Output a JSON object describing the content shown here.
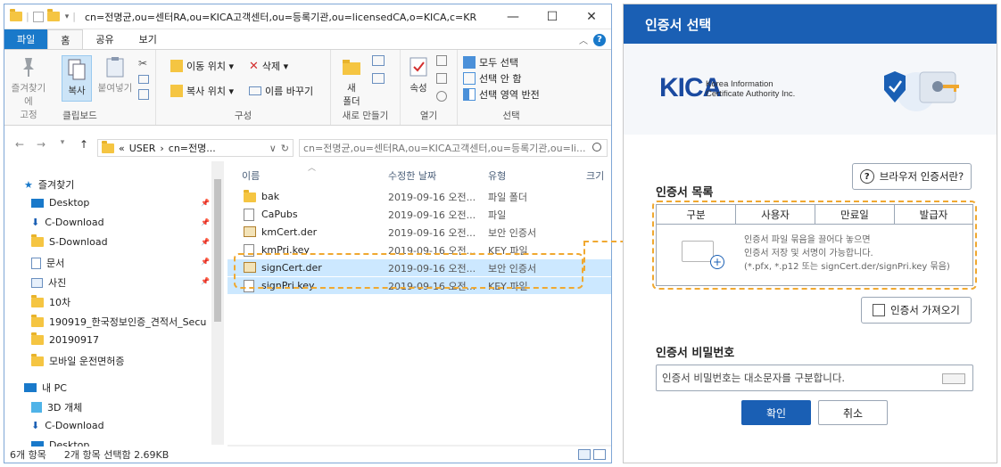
{
  "explorer": {
    "title": "cn=전명균,ou=센터RA,ou=KICA고객센터,ou=등록기관,ou=licensedCA,o=KICA,c=KR",
    "window_buttons": {
      "minimize": "—",
      "maximize": "☐",
      "close": "✕"
    },
    "tabs": [
      {
        "label": "파일"
      },
      {
        "label": "홈"
      },
      {
        "label": "공유"
      },
      {
        "label": "보기"
      }
    ],
    "ribbon": {
      "clipboard": {
        "pin_label": "즐겨찾기에\n고정",
        "copy_label": "복사",
        "paste_label": "붙여넣기",
        "group_label": "클립보드"
      },
      "organize": {
        "move_label": "이동 위치 ▾",
        "copy_to_label": "복사 위치 ▾",
        "delete_label": "삭제 ▾",
        "rename_label": "이름 바꾸기",
        "group_label": "구성"
      },
      "new": {
        "new_folder_label": "새\n폴더",
        "group_label": "새로 만들기"
      },
      "open": {
        "properties_label": "속성",
        "group_label": "열기"
      },
      "select": {
        "select_all_label": "모두 선택",
        "select_none_label": "선택 안 함",
        "invert_label": "선택 영역 반전",
        "group_label": "선택"
      }
    },
    "address": {
      "chevrons": "«",
      "crumb1": "USER",
      "crumb2": "cn=전명...",
      "search_text": "cn=전명균,ou=센터RA,ou=KICA고객센터,ou=등록기관,ou=li..."
    },
    "nav": {
      "items": [
        {
          "label": "즐겨찾기"
        },
        {
          "label": "Desktop"
        },
        {
          "label": "C-Download"
        },
        {
          "label": "S-Download"
        },
        {
          "label": "문서"
        },
        {
          "label": "사진"
        },
        {
          "label": "10차"
        },
        {
          "label": "190919_한국정보인증_견적서_Secu"
        },
        {
          "label": "20190917"
        },
        {
          "label": "모바일 운전면허증"
        },
        {
          "label": "내 PC"
        },
        {
          "label": "3D 개체"
        },
        {
          "label": "C-Download"
        },
        {
          "label": "Desktop"
        }
      ]
    },
    "columns": {
      "name": "이름",
      "date": "수정한 날짜",
      "type": "유형",
      "size": "크기"
    },
    "files": [
      {
        "name": "bak",
        "date": "2019-09-16 오전...",
        "type": "파일 폴더"
      },
      {
        "name": "CaPubs",
        "date": "2019-09-16 오전...",
        "type": "파일"
      },
      {
        "name": "kmCert.der",
        "date": "2019-09-16 오전...",
        "type": "보안 인증서"
      },
      {
        "name": "kmPri.key",
        "date": "2019-09-16 오전...",
        "type": "KEY 파일"
      },
      {
        "name": "signCert.der",
        "date": "2019-09-16 오전...",
        "type": "보안 인증서"
      },
      {
        "name": "signPri.key",
        "date": "2019-09-16 오전...",
        "type": "KEY 파일"
      }
    ],
    "status": {
      "count": "6개 항목",
      "selected": "2개 항목 선택함 2.69KB"
    }
  },
  "dialog": {
    "title": "인증서 선택",
    "logo_letters": "KICA",
    "logo_sub1": "Korea Information",
    "logo_sub2": "Certificate Authority Inc.",
    "browser_cert_button": "브라우저 인증서란?",
    "cert_list_label": "인증서 목록",
    "table_headers": [
      "구분",
      "사용자",
      "만료일",
      "발급자"
    ],
    "empty_line1": "인증서 파일 묶음을 끌어다 놓으면",
    "empty_line2": "인증서 저장 및 서명이 가능합니다.",
    "empty_line3": "(*.pfx, *.p12 또는 signCert.der/signPri.key 묶음)",
    "import_button": "인증서 가져오기",
    "password_label": "인증서 비밀번호",
    "password_placeholder": "인증서 비밀번호는 대소문자를 구분합니다.",
    "ok_button": "확인",
    "cancel_button": "취소",
    "accent_color": "#1a5fb4",
    "highlight_color": "#f0a830"
  }
}
